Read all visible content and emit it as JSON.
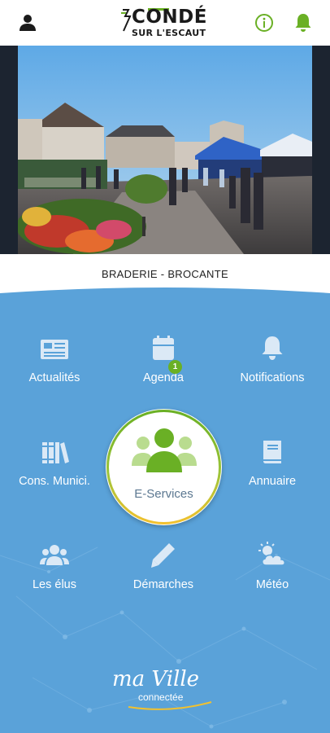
{
  "header": {
    "logo_line1": "CONDÉ",
    "logo_line2": "SUR L'ESCAUT",
    "icons": [
      "user-icon",
      "info-icon",
      "bell-icon"
    ]
  },
  "hero": {
    "caption": "BRADERIE - BROCANTE"
  },
  "menu": {
    "actualites": "Actualités",
    "agenda": "Agenda",
    "agenda_badge": "1",
    "notifications": "Notifications",
    "cons_munici": "Cons. Munici.",
    "eservices": "E-Services",
    "annuaire": "Annuaire",
    "les_elus": "Les élus",
    "demarches": "Démarches",
    "meteo": "Météo"
  },
  "brand": {
    "line1": "ma Ville",
    "line2": "connectée"
  },
  "colors": {
    "panel_blue": "#5aa2d9",
    "accent_green": "#6ab025",
    "ring_yellow": "#f2c12e",
    "text_dark": "#222222"
  }
}
